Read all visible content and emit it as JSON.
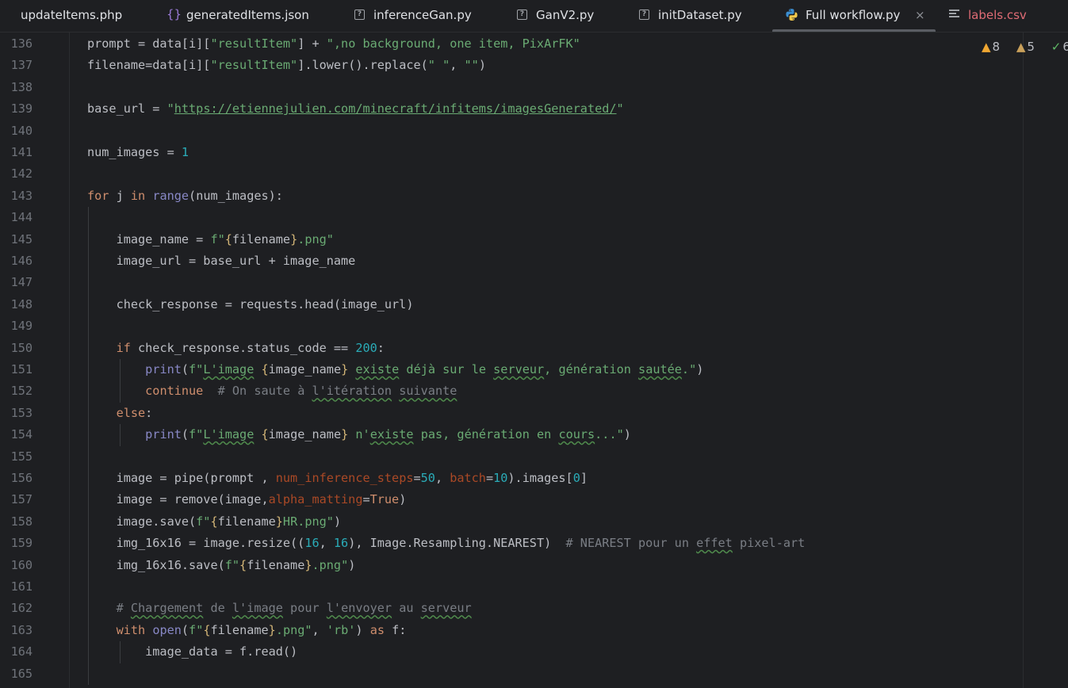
{
  "tabs": [
    {
      "label": "updateItems.php",
      "icon": "php-file-icon"
    },
    {
      "label": "generatedItems.json",
      "icon": "json-braces-icon"
    },
    {
      "label": "inferenceGan.py",
      "icon": "unknown-file-icon"
    },
    {
      "label": "GanV2.py",
      "icon": "unknown-file-icon"
    },
    {
      "label": "initDataset.py",
      "icon": "unknown-file-icon"
    },
    {
      "label": "Full workflow.py",
      "icon": "python-icon",
      "active": true
    },
    {
      "label": "labels.csv",
      "icon": "text-lines-icon"
    }
  ],
  "close_glyph": "×",
  "inspections": {
    "errors": "8",
    "warnings": "5",
    "ok": "6"
  },
  "lines": [
    {
      "n": "136",
      "text": "prompt = data[i][\"resultItem\"] + \",no background, one item, PixArFK\""
    },
    {
      "n": "137",
      "text": "filename=data[i][\"resultItem\"].lower().replace(\" \", \"\")"
    },
    {
      "n": "138",
      "text": ""
    },
    {
      "n": "139",
      "text": "base_url = \"https://etiennejulien.com/minecraft/infitems/imagesGenerated/\""
    },
    {
      "n": "140",
      "text": ""
    },
    {
      "n": "141",
      "text": "num_images = 1"
    },
    {
      "n": "142",
      "text": ""
    },
    {
      "n": "143",
      "text": "for j in range(num_images):"
    },
    {
      "n": "144",
      "text": ""
    },
    {
      "n": "145",
      "text": "    image_name = f\"{filename}.png\""
    },
    {
      "n": "146",
      "text": "    image_url = base_url + image_name"
    },
    {
      "n": "147",
      "text": ""
    },
    {
      "n": "148",
      "text": "    check_response = requests.head(image_url)"
    },
    {
      "n": "149",
      "text": ""
    },
    {
      "n": "150",
      "text": "    if check_response.status_code == 200:"
    },
    {
      "n": "151",
      "text": "        print(f\"L'image {image_name} existe déjà sur le serveur, génération sautée.\")"
    },
    {
      "n": "152",
      "text": "        continue  # On saute à l'itération suivante"
    },
    {
      "n": "153",
      "text": "    else:"
    },
    {
      "n": "154",
      "text": "        print(f\"L'image {image_name} n'existe pas, génération en cours...\")"
    },
    {
      "n": "155",
      "text": ""
    },
    {
      "n": "156",
      "text": "    image = pipe(prompt , num_inference_steps=50, batch=10).images[0]"
    },
    {
      "n": "157",
      "text": "    image = remove(image,alpha_matting=True)"
    },
    {
      "n": "158",
      "text": "    image.save(f\"{filename}HR.png\")"
    },
    {
      "n": "159",
      "text": "    img_16x16 = image.resize((16, 16), Image.Resampling.NEAREST)  # NEAREST pour un effet pixel-art"
    },
    {
      "n": "160",
      "text": "    img_16x16.save(f\"{filename}.png\")"
    },
    {
      "n": "161",
      "text": ""
    },
    {
      "n": "162",
      "text": "    # Chargement de l'image pour l'envoyer au serveur"
    },
    {
      "n": "163",
      "text": "    with open(f\"{filename}.png\", 'rb') as f:"
    },
    {
      "n": "164",
      "text": "        image_data = f.read()"
    },
    {
      "n": "165",
      "text": ""
    }
  ]
}
